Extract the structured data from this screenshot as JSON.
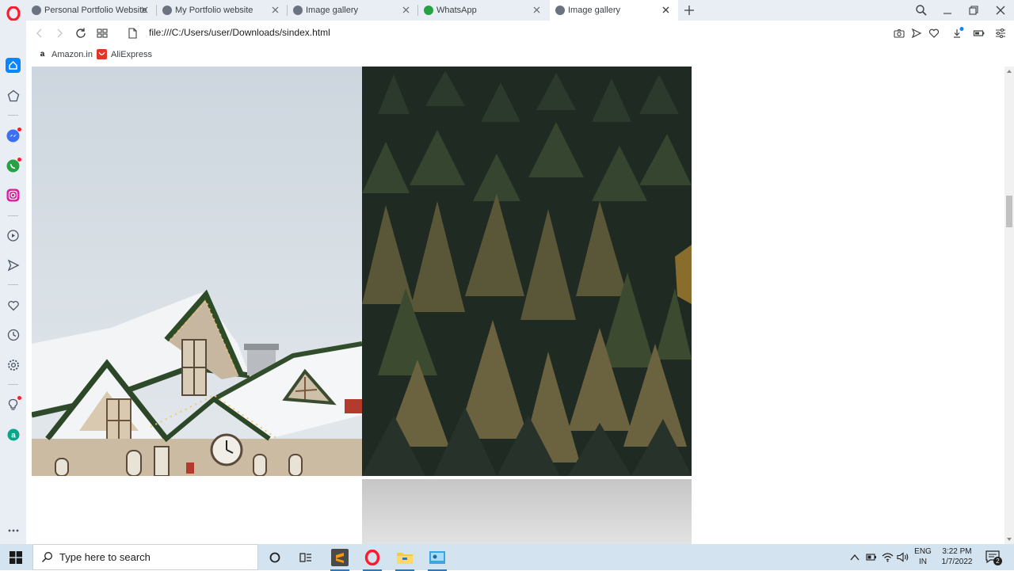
{
  "tabs": [
    {
      "label": "Personal Portfolio Website",
      "active": false
    },
    {
      "label": "My Portfolio website",
      "active": false
    },
    {
      "label": "Image gallery",
      "active": false
    },
    {
      "label": "WhatsApp",
      "active": false
    },
    {
      "label": "Image gallery",
      "active": true
    }
  ],
  "address_bar": {
    "url": "file:///C:/Users/user/Downloads/sindex.html"
  },
  "bookmarks": [
    {
      "label": "Amazon.in",
      "icon": "amazon-icon"
    },
    {
      "label": "AliExpress",
      "icon": "aliexpress-icon"
    }
  ],
  "gallery": {
    "images": [
      {
        "subject": "snowy-chalet-with-garlands",
        "icon": "photo"
      },
      {
        "subject": "pine-forest-aerial",
        "icon": "photo"
      },
      {
        "subject": "grey-sky-partial",
        "icon": "photo"
      }
    ]
  },
  "taskbar": {
    "search_placeholder": "Type here to search",
    "language_line1": "ENG",
    "language_line2": "IN",
    "time": "3:22 PM",
    "date": "1/7/2022",
    "notification_count": "2"
  },
  "colors": {
    "sidebar_bg": "#e9eef5",
    "opera_red": "#ff1b2d",
    "taskbar_bg": "#d3e3ef",
    "accent_blue": "#2b79c5"
  }
}
